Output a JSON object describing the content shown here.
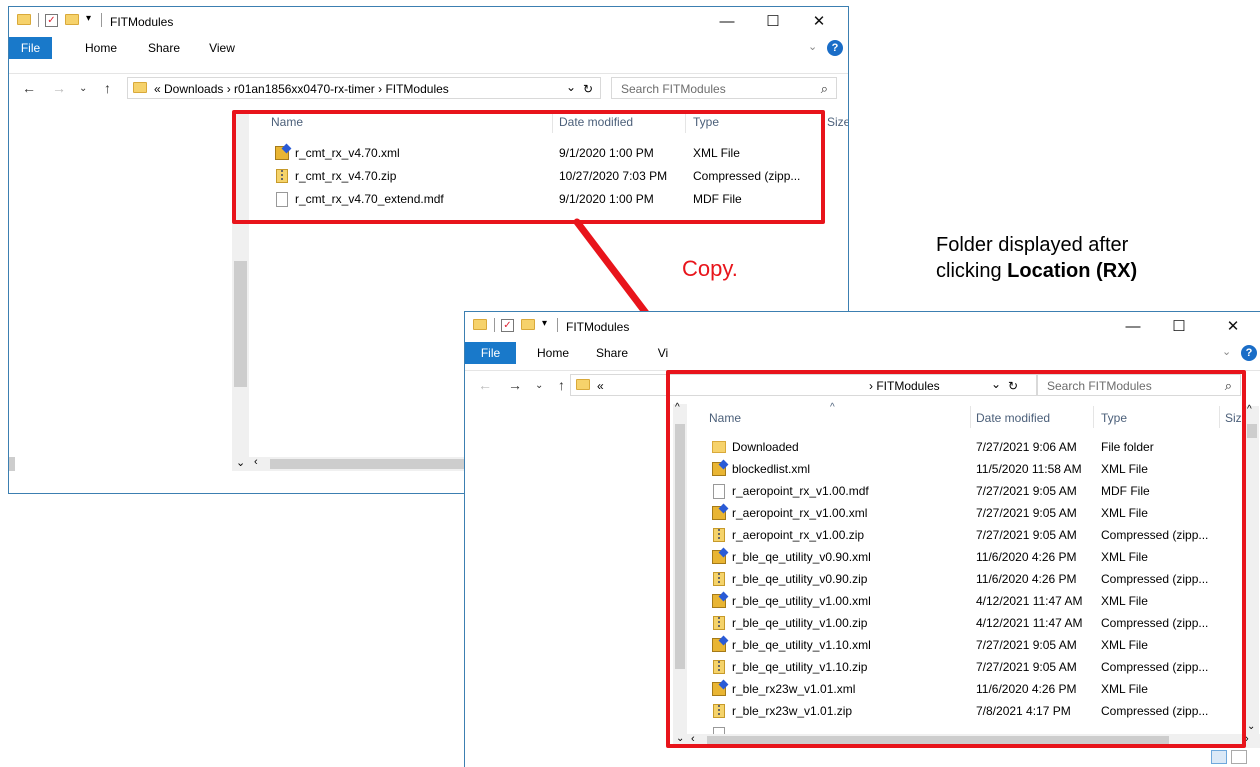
{
  "window1": {
    "title": "FITModules",
    "ribbon_tabs": [
      "File",
      "Home",
      "Share",
      "View"
    ],
    "breadcrumb": "«  Downloads  ›  r01an1856xx0470-rx-timer  ›  FITModules",
    "search_placeholder": "Search FITModules",
    "columns": [
      "Name",
      "Date modified",
      "Type",
      "Size"
    ],
    "files": [
      {
        "name": "r_cmt_rx_v4.70.xml",
        "date": "9/1/2020 1:00 PM",
        "type": "XML File",
        "icon": "xml"
      },
      {
        "name": "r_cmt_rx_v4.70.zip",
        "date": "10/27/2020 7:03 PM",
        "type": "Compressed (zipp...",
        "icon": "zip"
      },
      {
        "name": "r_cmt_rx_v4.70_extend.mdf",
        "date": "9/1/2020 1:00 PM",
        "type": "MDF File",
        "icon": "mdf"
      }
    ]
  },
  "window2": {
    "title": "FITModules",
    "ribbon_tabs": [
      "File",
      "Home",
      "Share",
      "Vi"
    ],
    "breadcrumb_prefix": "«",
    "breadcrumb": "›  FITModules",
    "search_placeholder": "Search FITModules",
    "columns": [
      "Name",
      "Date modified",
      "Type",
      "Siz"
    ],
    "files": [
      {
        "name": "Downloaded",
        "date": "7/27/2021 9:06 AM",
        "type": "File folder",
        "icon": "folder"
      },
      {
        "name": "blockedlist.xml",
        "date": "11/5/2020 11:58 AM",
        "type": "XML File",
        "icon": "xml"
      },
      {
        "name": "r_aeropoint_rx_v1.00.mdf",
        "date": "7/27/2021 9:05 AM",
        "type": "MDF File",
        "icon": "mdf"
      },
      {
        "name": "r_aeropoint_rx_v1.00.xml",
        "date": "7/27/2021 9:05 AM",
        "type": "XML File",
        "icon": "xml"
      },
      {
        "name": "r_aeropoint_rx_v1.00.zip",
        "date": "7/27/2021 9:05 AM",
        "type": "Compressed (zipp...",
        "icon": "zip"
      },
      {
        "name": "r_ble_qe_utility_v0.90.xml",
        "date": "11/6/2020 4:26 PM",
        "type": "XML File",
        "icon": "xml"
      },
      {
        "name": "r_ble_qe_utility_v0.90.zip",
        "date": "11/6/2020 4:26 PM",
        "type": "Compressed (zipp...",
        "icon": "zip"
      },
      {
        "name": "r_ble_qe_utility_v1.00.xml",
        "date": "4/12/2021 11:47 AM",
        "type": "XML File",
        "icon": "xml"
      },
      {
        "name": "r_ble_qe_utility_v1.00.zip",
        "date": "4/12/2021 11:47 AM",
        "type": "Compressed (zipp...",
        "icon": "zip"
      },
      {
        "name": "r_ble_qe_utility_v1.10.xml",
        "date": "7/27/2021 9:05 AM",
        "type": "XML File",
        "icon": "xml"
      },
      {
        "name": "r_ble_qe_utility_v1.10.zip",
        "date": "7/27/2021 9:05 AM",
        "type": "Compressed (zipp...",
        "icon": "zip"
      },
      {
        "name": "r_ble_rx23w_v1.01.xml",
        "date": "11/6/2020 4:26 PM",
        "type": "XML File",
        "icon": "xml"
      },
      {
        "name": "r_ble_rx23w_v1.01.zip",
        "date": "7/8/2021 4:17 PM",
        "type": "Compressed (zipp...",
        "icon": "zip"
      }
    ]
  },
  "annotations": {
    "copy_label": "Copy.",
    "note_line1": "Folder displayed after",
    "note_line2_prefix": "clicking ",
    "note_line2_bold": "Location (RX)"
  },
  "colors": {
    "highlight_red": "#e8141b",
    "ribbon_blue": "#1979ca"
  }
}
